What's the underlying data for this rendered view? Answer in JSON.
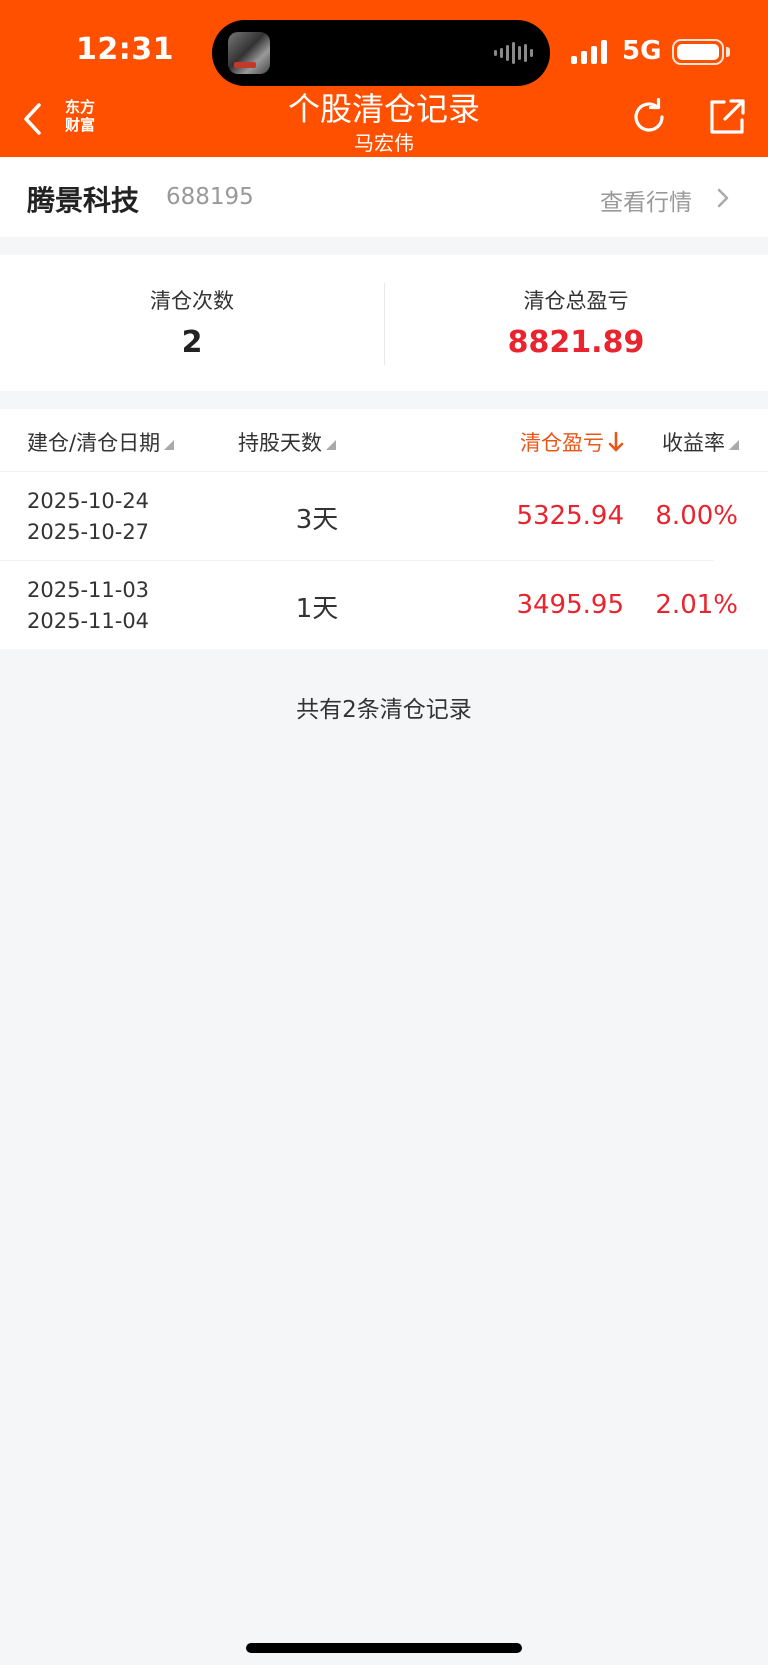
{
  "status_bar": {
    "time": "12:31",
    "network": "5G"
  },
  "nav": {
    "logo_line1": "东方",
    "logo_line2": "财富",
    "title": "个股清仓记录",
    "subtitle": "马宏伟"
  },
  "stock": {
    "name": "腾景科技",
    "code": "688195",
    "view_quote": "查看行情"
  },
  "summary": {
    "count_label": "清仓次数",
    "count_value": "2",
    "total_label": "清仓总盈亏",
    "total_value": "8821.89"
  },
  "table": {
    "headers": {
      "date": "建仓/清仓日期",
      "days": "持股天数",
      "pnl": "清仓盈亏",
      "rate": "收益率"
    },
    "rows": [
      {
        "open_date": "2025-10-24",
        "close_date": "2025-10-27",
        "days": "3天",
        "pnl": "5325.94",
        "rate": "8.00%"
      },
      {
        "open_date": "2025-11-03",
        "close_date": "2025-11-04",
        "days": "1天",
        "pnl": "3495.95",
        "rate": "2.01%"
      }
    ]
  },
  "footer": {
    "note": "共有2条清仓记录"
  },
  "colors": {
    "brand": "#ff5000",
    "profit_red": "#e8242e",
    "active_sort": "#e8561a"
  }
}
